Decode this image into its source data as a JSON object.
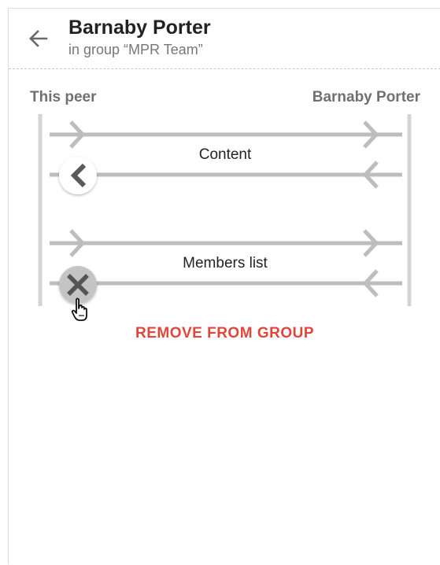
{
  "header": {
    "title": "Barnaby Porter",
    "subtitle": "in group “MPR Team”",
    "back_icon": "arrow-left-icon"
  },
  "peers": {
    "left": "This peer",
    "right": "Barnaby Porter"
  },
  "exchanges": [
    {
      "label": "Content",
      "status_icon": "chevron-left-icon"
    },
    {
      "label": "Members list",
      "status_icon": "close-icon"
    }
  ],
  "actions": {
    "remove_label": "REMOVE FROM GROUP"
  },
  "colors": {
    "accent_red": "#e0463c",
    "line_gray": "#bdbdbd",
    "badge_gray": "#c4c4c4"
  }
}
